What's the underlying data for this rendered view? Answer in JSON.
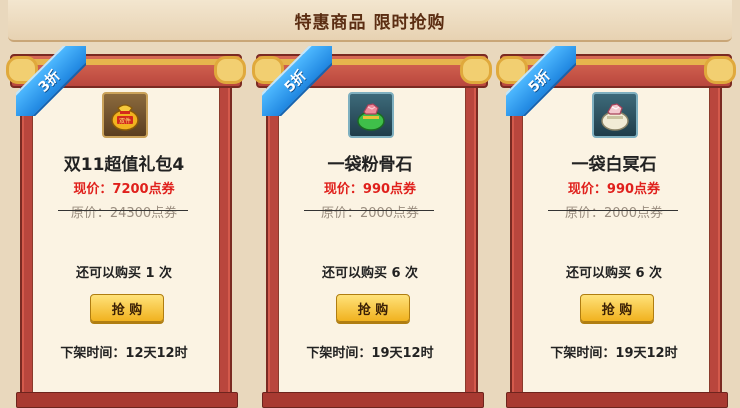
{
  "header": {
    "title": "特惠商品  限时抢购"
  },
  "cards": [
    {
      "discount": "3折",
      "name": "双11超值礼包4",
      "price_now": "现价：7200点券",
      "price_old": "原价：24300点券",
      "limit": "还可以购买 1 次",
      "buy_label": "抢 购",
      "offline": "下架时间：12天12时",
      "icon": "lucky-bag-icon"
    },
    {
      "discount": "5折",
      "name": "一袋粉骨石",
      "price_now": "现价：990点券",
      "price_old": "原价：2000点券",
      "limit": "还可以购买 6 次",
      "buy_label": "抢 购",
      "offline": "下架时间：19天12时",
      "icon": "pink-stone-bag-icon"
    },
    {
      "discount": "5折",
      "name": "一袋白冥石",
      "price_now": "现价：990点券",
      "price_old": "原价：2000点券",
      "limit": "还可以购买 6 次",
      "buy_label": "抢 购",
      "offline": "下架时间：19天12时",
      "icon": "white-stone-bag-icon"
    }
  ],
  "colors": {
    "price_now": "#e0201c",
    "ribbon": "#1f86e0",
    "frame": "#b9463d",
    "button": "#f1b21f"
  }
}
